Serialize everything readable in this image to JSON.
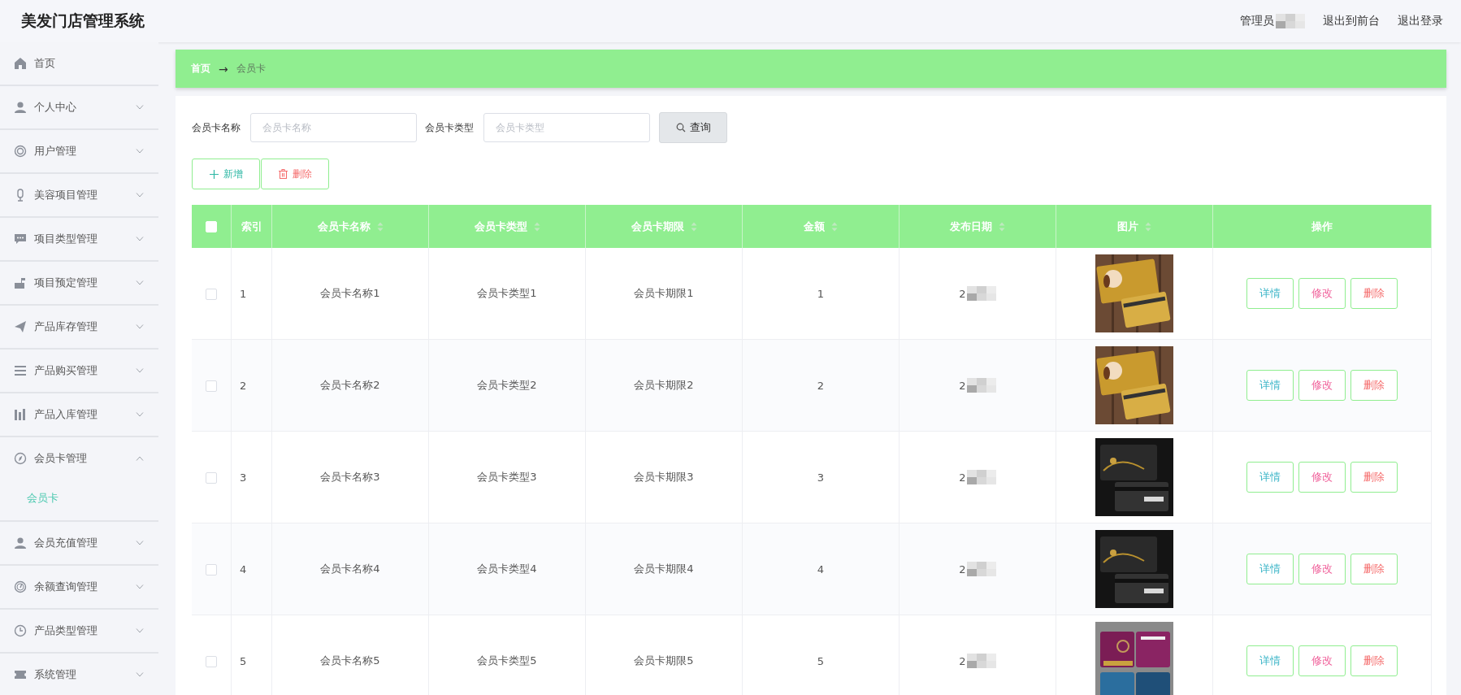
{
  "header": {
    "title": "美发门店管理系统",
    "user_label": "管理员",
    "links": [
      "退出到前台",
      "退出登录"
    ]
  },
  "sidebar": {
    "items": [
      {
        "label": "首页",
        "kind": "link"
      },
      {
        "label": "个人中心",
        "kind": "menu",
        "expanded": false
      },
      {
        "label": "用户管理",
        "kind": "menu",
        "expanded": false
      },
      {
        "label": "美容项目管理",
        "kind": "menu",
        "expanded": false
      },
      {
        "label": "项目类型管理",
        "kind": "menu",
        "expanded": false
      },
      {
        "label": "项目预定管理",
        "kind": "menu",
        "expanded": false
      },
      {
        "label": "产品库存管理",
        "kind": "menu",
        "expanded": false
      },
      {
        "label": "产品购买管理",
        "kind": "menu",
        "expanded": false
      },
      {
        "label": "产品入库管理",
        "kind": "menu",
        "expanded": false
      },
      {
        "label": "会员卡管理",
        "kind": "menu",
        "expanded": true,
        "children": [
          {
            "label": "会员卡",
            "selected": true
          }
        ]
      },
      {
        "label": "会员充值管理",
        "kind": "menu",
        "expanded": false
      },
      {
        "label": "余额查询管理",
        "kind": "menu",
        "expanded": false
      },
      {
        "label": "产品类型管理",
        "kind": "menu",
        "expanded": false
      },
      {
        "label": "系统管理",
        "kind": "menu",
        "expanded": false
      }
    ]
  },
  "breadcrumb": {
    "home": "首页",
    "separator": "→",
    "current": "会员卡"
  },
  "search": {
    "fields": [
      {
        "label": "会员卡名称",
        "placeholder": "会员卡名称"
      },
      {
        "label": "会员卡类型",
        "placeholder": "会员卡类型"
      }
    ],
    "button": "查询"
  },
  "actions": [
    {
      "label": "新增",
      "kind": "add"
    },
    {
      "label": "删除",
      "kind": "delete"
    }
  ],
  "table": {
    "select_all_checked": false,
    "columns": [
      {
        "label": "索引",
        "sortable": false
      },
      {
        "label": "会员卡名称",
        "sortable": true
      },
      {
        "label": "会员卡类型",
        "sortable": true
      },
      {
        "label": "会员卡期限",
        "sortable": true
      },
      {
        "label": "金额",
        "sortable": true
      },
      {
        "label": "发布日期",
        "sortable": true
      },
      {
        "label": "图片",
        "sortable": true
      },
      {
        "label": "操作",
        "sortable": false
      }
    ],
    "rows": [
      {
        "checked": false,
        "index": "1",
        "name": "会员卡名称1",
        "type": "会员卡类型1",
        "term": "会员卡期限1",
        "amount": "1",
        "date": "2",
        "buttons": [
          {
            "label": "详情",
            "color": "#40b7c9"
          },
          {
            "label": "修改",
            "color": "#f0609a"
          },
          {
            "label": "删除",
            "color": "#f56c6c"
          }
        ]
      },
      {
        "checked": false,
        "index": "2",
        "name": "会员卡名称2",
        "type": "会员卡类型2",
        "term": "会员卡期限2",
        "amount": "2",
        "date": "2",
        "buttons": [
          {
            "label": "详情",
            "color": "#40b7c9"
          },
          {
            "label": "修改",
            "color": "#f0609a"
          },
          {
            "label": "删除",
            "color": "#f56c6c"
          }
        ]
      },
      {
        "checked": false,
        "index": "3",
        "name": "会员卡名称3",
        "type": "会员卡类型3",
        "term": "会员卡期限3",
        "amount": "3",
        "date": "2",
        "buttons": [
          {
            "label": "详情",
            "color": "#40b7c9"
          },
          {
            "label": "修改",
            "color": "#f0609a"
          },
          {
            "label": "删除",
            "color": "#f56c6c"
          }
        ]
      },
      {
        "checked": false,
        "index": "4",
        "name": "会员卡名称4",
        "type": "会员卡类型4",
        "term": "会员卡期限4",
        "amount": "4",
        "date": "2",
        "buttons": [
          {
            "label": "详情",
            "color": "#40b7c9"
          },
          {
            "label": "修改",
            "color": "#f0609a"
          },
          {
            "label": "删除",
            "color": "#f56c6c"
          }
        ]
      },
      {
        "checked": false,
        "index": "5",
        "name": "会员卡名称5",
        "type": "会员卡类型5",
        "term": "会员卡期限5",
        "amount": "5",
        "date": "2",
        "buttons": [
          {
            "label": "详情",
            "color": "#40b7c9"
          },
          {
            "label": "修改",
            "color": "#f0609a"
          },
          {
            "label": "删除",
            "color": "#f56c6c"
          }
        ]
      }
    ]
  }
}
